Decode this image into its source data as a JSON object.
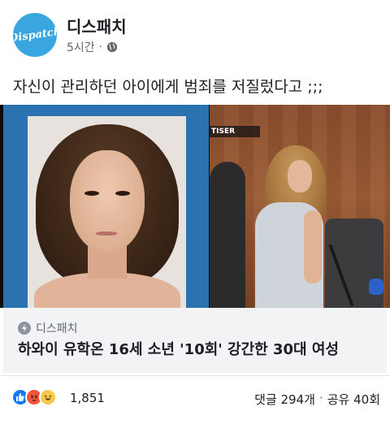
{
  "post": {
    "page_name": "디스패치",
    "avatar_text": "Dispatch",
    "time": "5시간",
    "separator": "·",
    "text": "자신이 관리하던 아이에게 범죄를 저질렀다고 ;;;"
  },
  "media": {
    "right_photo_tag": "TISER"
  },
  "link": {
    "source": "디스패치",
    "headline": "하와이 유학온 16세 소년 '10회' 강간한 30대 여성"
  },
  "reactions": {
    "icons": [
      "like-icon",
      "angry-icon",
      "haha-icon"
    ],
    "count": "1,851"
  },
  "stats": {
    "comments": "댓글 294개",
    "separator": "·",
    "shares": "공유 40회"
  },
  "colors": {
    "like": "#1877f2",
    "angry": "#f0553a",
    "haha": "#f7c84b",
    "avatar": "#3aa6e0"
  }
}
